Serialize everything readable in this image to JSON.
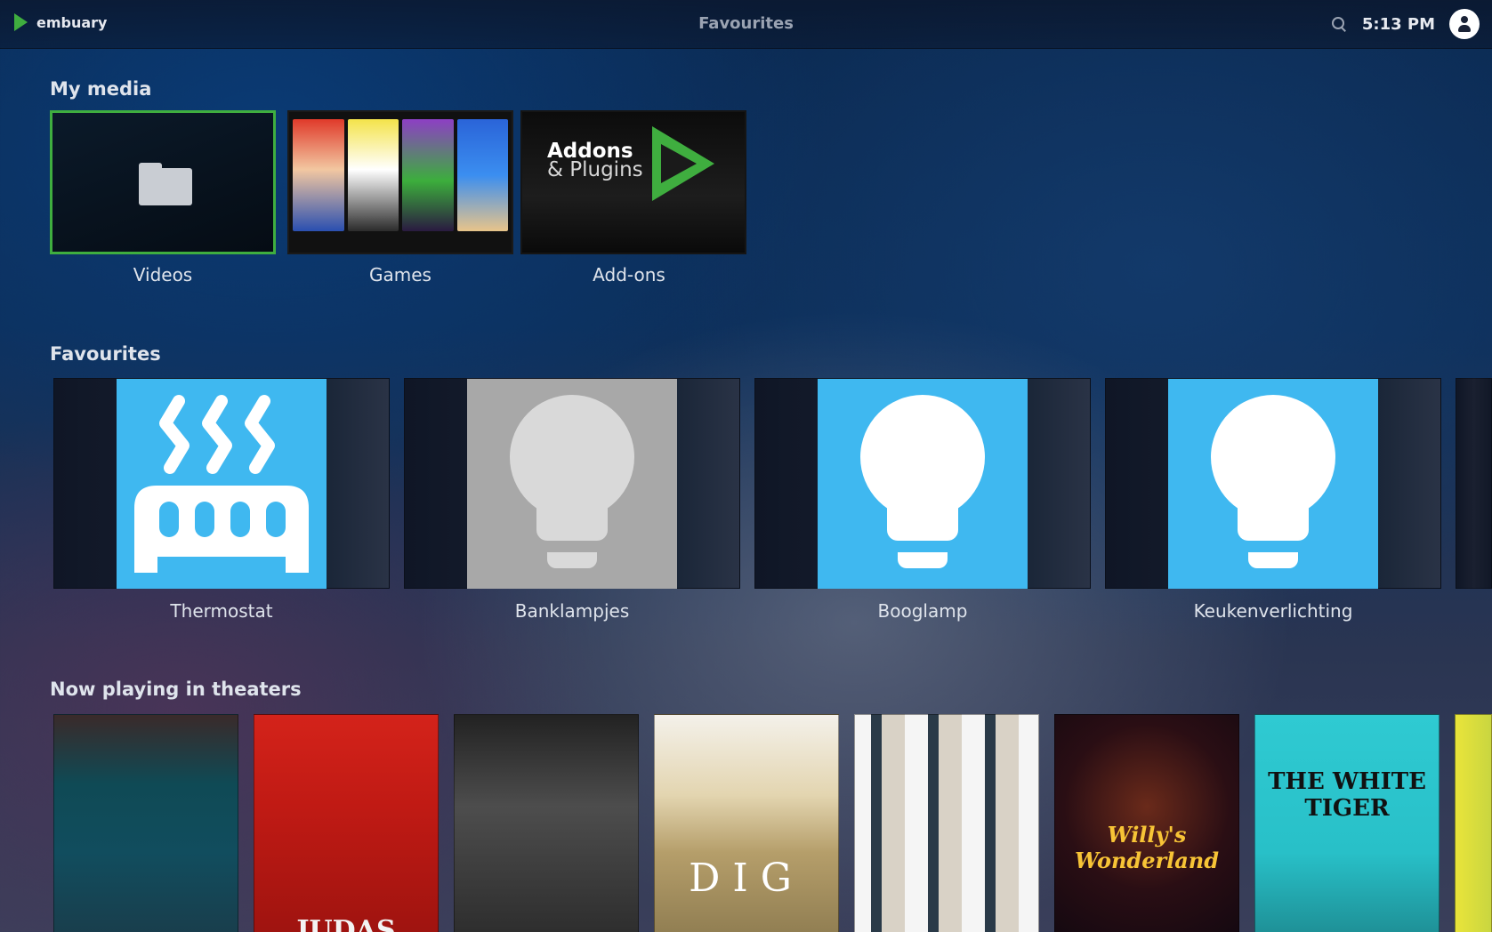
{
  "header": {
    "app_name": "embuary",
    "page_title": "Favourites",
    "clock": "5:13 PM"
  },
  "sections": {
    "my_media": "My media",
    "favourites": "Favourites",
    "theaters": "Now playing in theaters"
  },
  "my_media": [
    {
      "label": "Videos"
    },
    {
      "label": "Games"
    },
    {
      "label": "Add-ons"
    }
  ],
  "addons_tile": {
    "line1": "Addons",
    "line2": "& Plugins"
  },
  "favourites": [
    {
      "label": "Thermostat",
      "icon": "thermostat-icon",
      "color": "#3fb8f0"
    },
    {
      "label": "Banklampjes",
      "icon": "bulb-icon",
      "color": "#a8a8a8"
    },
    {
      "label": "Booglamp",
      "icon": "bulb-icon",
      "color": "#3fb8f0"
    },
    {
      "label": "Keukenverlichting",
      "icon": "bulb-icon",
      "color": "#3fb8f0"
    }
  ],
  "theaters": [
    {
      "text": ""
    },
    {
      "text": "JUDAS"
    },
    {
      "text": ""
    },
    {
      "text": "DIG"
    },
    {
      "text": ""
    },
    {
      "text": "Willy's Wonderland"
    },
    {
      "text": "THE WHITE TIGER"
    },
    {
      "text": ""
    }
  ],
  "colors": {
    "accent": "#3fae3f",
    "tile_blue": "#3fb8f0"
  }
}
